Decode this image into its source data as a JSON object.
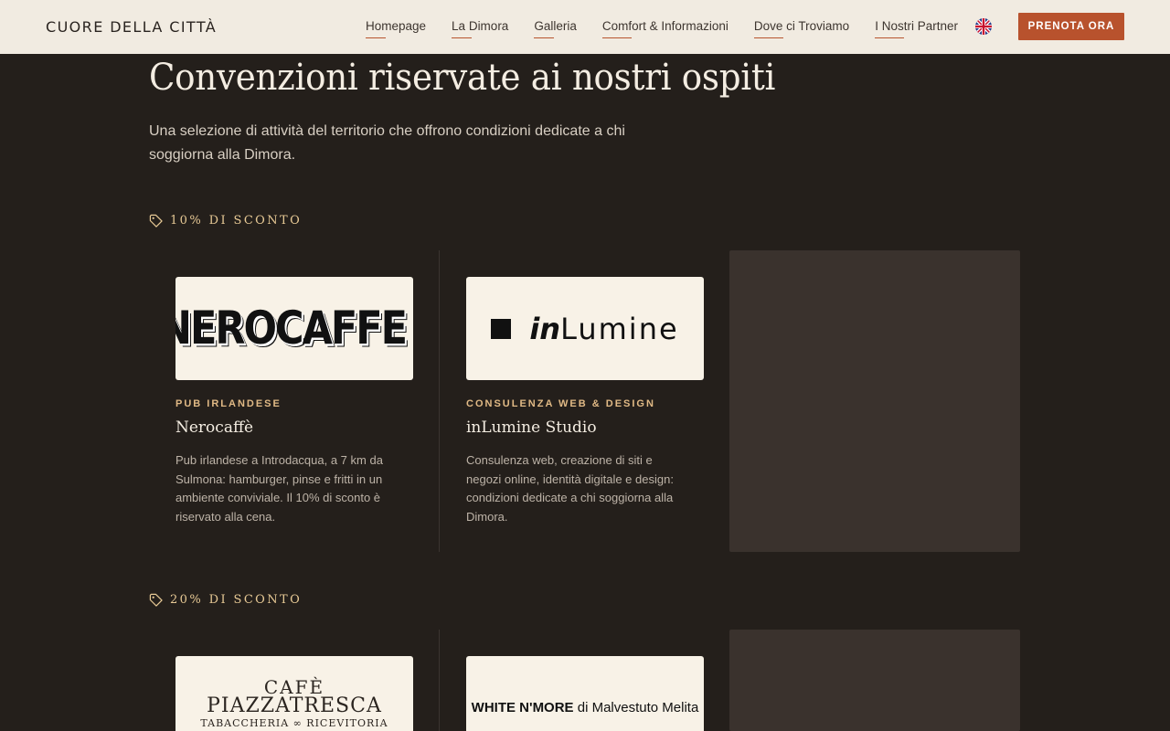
{
  "header": {
    "brand": "CUORE DELLA CITTÀ",
    "nav": [
      "Homepage",
      "La Dimora",
      "Galleria",
      "Comfort & Informazioni",
      "Dove ci Troviamo",
      "I Nostri Partner"
    ],
    "language_icon": "uk-flag-icon",
    "cta_label": "PRENOTA ORA"
  },
  "page": {
    "title": "Convenzioni riservate ai nostri ospiti",
    "subtitle": "Una selezione di attività del territorio che offrono condizioni dedicate a chi soggiorna alla Dimora."
  },
  "sections": [
    {
      "label": "10% DI SCONTO",
      "icon": "tag-icon",
      "cards": [
        {
          "logo_text": "NEROCAFFE",
          "category": "PUB IRLANDESE",
          "name": "Nerocaffè",
          "description": "Pub irlandese a Introdacqua, a 7 km da Sulmona: hamburger, pinse e fritti in un ambiente conviviale. Il 10% di sconto è riservato alla cena."
        },
        {
          "logo_text_italic": "in",
          "logo_text": "Lumine",
          "category": "CONSULENZA WEB & DESIGN",
          "name": "inLumine Studio",
          "description": "Consulenza web, creazione di siti e negozi online, identità digitale e design: condizioni dedicate a chi soggiorna alla Dimora."
        }
      ]
    },
    {
      "label": "20% DI SCONTO",
      "icon": "tag-icon",
      "cards": [
        {
          "logo_line1": "CAFÈ",
          "logo_line2": "PIAZZATRESCA",
          "logo_line3": "TABACCHERIA ∞ RICEVITORIA"
        },
        {
          "logo_bold": "WHITE N'MORE",
          "logo_rest": " di Malvestuto Melita"
        }
      ]
    }
  ]
}
